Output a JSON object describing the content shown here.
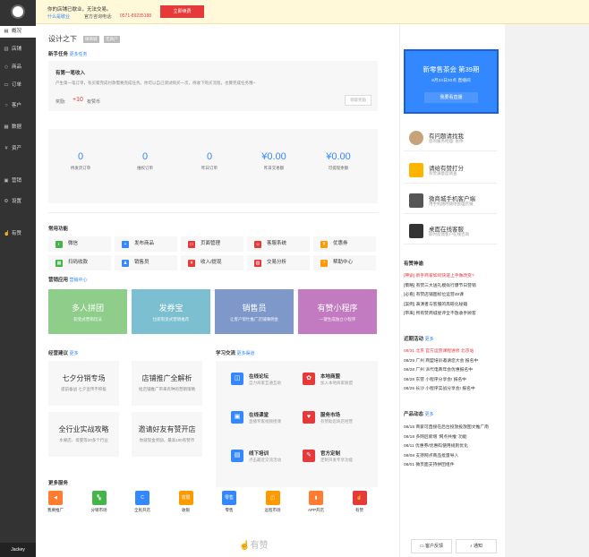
{
  "sidebar": {
    "user": "Jackey",
    "items": [
      {
        "label": "概况",
        "icon": "home-icon",
        "glyph": "▤",
        "active": true
      },
      {
        "label": "店铺",
        "icon": "store-icon",
        "glyph": "▥",
        "active": false
      },
      {
        "label": "商品",
        "icon": "tag-icon",
        "glyph": "◇",
        "active": false
      },
      {
        "label": "订单",
        "icon": "order-icon",
        "glyph": "▭",
        "active": false
      },
      {
        "label": "客户",
        "icon": "user-icon",
        "glyph": "○",
        "active": false
      },
      {
        "label": "数据",
        "icon": "chart-icon",
        "glyph": "▦",
        "active": false
      },
      {
        "label": "资产",
        "icon": "wallet-icon",
        "glyph": "¥",
        "active": false
      },
      {
        "label": "营销",
        "icon": "marketing-icon",
        "glyph": "▣",
        "active": false
      },
      {
        "label": "设置",
        "icon": "gear-icon",
        "glyph": "⚙",
        "active": false
      },
      {
        "label": "有赞",
        "icon": "thumb-icon",
        "glyph": "☝",
        "active": false
      }
    ]
  },
  "notice": {
    "text": "你的店铺已歇业，无法交易。",
    "link": "什么是歇业",
    "phone_label": "官方咨询电话:",
    "phone": "0571-89235188",
    "button": "立即续费"
  },
  "header": {
    "title": "设计之下",
    "tag1": "微商城",
    "tag2": "无商户"
  },
  "task": {
    "section": "新手任务",
    "more": "更多任务",
    "title": "有第一笔收入",
    "desc": "产生第一笔订单，有买家完成付款需要完成任务。你可以自己测试购买一次，待收下购买流程，也算完成任务哦~",
    "reward_label": "奖励:",
    "reward_value": "+10",
    "reward_unit": "有赞币",
    "claim": "领取奖励"
  },
  "stats": [
    {
      "value": "0",
      "label": "待发货订单"
    },
    {
      "value": "0",
      "label": "维权订单"
    },
    {
      "value": "0",
      "label": "昨日订单"
    },
    {
      "value": "¥0.00",
      "label": "昨日交易额"
    },
    {
      "value": "¥0.00",
      "label": "可提现余额"
    }
  ],
  "functions": {
    "section": "常用功能",
    "items": [
      {
        "label": "微信",
        "icon": "wechat-icon",
        "color": "#44b549",
        "glyph": "◐"
      },
      {
        "label": "发布商品",
        "icon": "publish-icon",
        "color": "#3388ff",
        "glyph": "+"
      },
      {
        "label": "页面管理",
        "icon": "page-icon",
        "color": "#e5393a",
        "glyph": "▭"
      },
      {
        "label": "客服系统",
        "icon": "service-icon",
        "color": "#e5393a",
        "glyph": "☺"
      },
      {
        "label": "优惠券",
        "icon": "coupon-icon",
        "color": "#ff9900",
        "glyph": "¥"
      },
      {
        "label": "扫码收款",
        "icon": "scan-icon",
        "color": "#44b549",
        "glyph": "▦"
      },
      {
        "label": "销售员",
        "icon": "seller-icon",
        "color": "#3388ff",
        "glyph": "♟"
      },
      {
        "label": "收入/提现",
        "icon": "income-icon",
        "color": "#e5393a",
        "glyph": "¥"
      },
      {
        "label": "交易分析",
        "icon": "analysis-icon",
        "color": "#e5393a",
        "glyph": "▥"
      },
      {
        "label": "帮助中心",
        "icon": "help-icon",
        "color": "#ff9900",
        "glyph": "?"
      }
    ]
  },
  "apps": {
    "section": "营销应用",
    "more": "营销中心",
    "items": [
      {
        "title": "多人拼团",
        "sub": "裂变式营销玩法",
        "color": "#8fce8a"
      },
      {
        "title": "发券宝",
        "sub": "拉新裂变式营销推荐",
        "color": "#7cbfd0"
      },
      {
        "title": "销售员",
        "sub": "让客户帮忙推广店铺赚佣金",
        "color": "#7d98c9"
      },
      {
        "title": "有赞小程序",
        "sub": "一键生成独立小程序",
        "color": "#c27ac0"
      }
    ]
  },
  "advice": {
    "section": "经营建议",
    "more": "更多",
    "items": [
      {
        "title": "七夕分销专场",
        "sub": "提前备战 七夕宣传不积极"
      },
      {
        "title": "店铺推广全解析",
        "sub": "给店铺推广带来有种的营销策略"
      },
      {
        "title": "全行业实战攻略",
        "sub": "水果店、母婴等20多个行业"
      },
      {
        "title": "邀请好友有赞开店",
        "sub": "你就现金奖励，最高100有赞币"
      }
    ]
  },
  "learn": {
    "section": "学习交流",
    "more": "更多渠道",
    "items": [
      {
        "title": "在线论坛",
        "sub": "自力商家互通互助",
        "icon": "forum-icon",
        "color": "#3388ff",
        "glyph": "◫"
      },
      {
        "title": "本地商盟",
        "sub": "加入本地商家联盟",
        "icon": "alliance-icon",
        "color": "#e5393a",
        "glyph": "✿"
      },
      {
        "title": "在线课堂",
        "sub": "直播专家视频授课",
        "icon": "classroom-icon",
        "color": "#3388ff",
        "glyph": "▣"
      },
      {
        "title": "服务市场",
        "sub": "有赞助您商店经营",
        "icon": "market-icon",
        "color": "#e5393a",
        "glyph": "♥"
      },
      {
        "title": "线下培训",
        "sub": "点击最近交流活动",
        "icon": "training-icon",
        "color": "#3388ff",
        "glyph": "▤"
      },
      {
        "title": "官方定制",
        "sub": "定制开发专享功能",
        "icon": "custom-icon",
        "color": "#e5393a",
        "glyph": "✎"
      }
    ]
  },
  "more_services": {
    "section": "更多服务",
    "items": [
      {
        "label": "我要推广",
        "icon": "promote-icon",
        "color": "#ff7c30",
        "glyph": "◀"
      },
      {
        "label": "分销市场",
        "icon": "distribution-icon",
        "color": "#44b549",
        "glyph": "▚"
      },
      {
        "label": "全民开店",
        "icon": "shop-icon",
        "color": "#3388ff",
        "glyph": "C"
      },
      {
        "label": "收银",
        "icon": "cashier-icon",
        "color": "#ff9900",
        "glyph": "收银"
      },
      {
        "label": "零售",
        "icon": "retail-icon",
        "color": "#3388ff",
        "glyph": "零售"
      },
      {
        "label": "远程市场",
        "icon": "remote-icon",
        "color": "#ff9900",
        "glyph": "◰"
      },
      {
        "label": "APP开店",
        "icon": "app-icon",
        "color": "#ff7c30",
        "glyph": "▮"
      },
      {
        "label": "有赞",
        "icon": "youzan-icon",
        "color": "#e5393a",
        "glyph": "☝"
      }
    ]
  },
  "footer": {
    "brand": "有赞"
  },
  "right": {
    "promo": {
      "title": "新零售茶会 第39期",
      "sub": "8月24日20点 直播间",
      "button": "我要看直播"
    },
    "contacts": [
      {
        "title": "有问题请找我",
        "sub": "您的服务经理: 张伟",
        "icon": "avatar"
      },
      {
        "title": "请给有赞打分",
        "sub": "有赞满意度调查",
        "icon": "mail-icon"
      },
      {
        "title": "微商城手机客户端",
        "sub": "用手机随时随地管理店铺",
        "icon": "phone-icon"
      },
      {
        "title": "桌面在线客服",
        "sub": "即时反馈客户在线咨询",
        "icon": "desktop-icon"
      }
    ],
    "notices": {
      "section": "有赞神谕",
      "items": [
        "[神谕] 新手商家如何快速上手做改变?",
        "[策略] 有赞三大送礼模拟行爆节日营销",
        "[必看] 有赞店铺图标位运营49课",
        "[案例] 表演者与客服的高研化秘籍",
        "[带来] 所有赞商城星评全不放收手顾客"
      ]
    },
    "events": {
      "section": "近期活动",
      "more": "更多",
      "items": [
        "08/31 北京 官方运营课程进修 北京站",
        "08/29 广州 商盟培训邀请您大会 报名中",
        "08/28 广州 派代电商年会优惠报名中",
        "08/28 东营 小程序分享会! 报名中",
        "08/25 长沙 小程序实战分享会! 报名中"
      ]
    },
    "product": {
      "section": "产品动态",
      "more": "更多",
      "items": [
        "08/18 商家可直接在后台投放投放图文推广南",
        "08/18 多网后新增 '网点共推' 功能",
        "08/11 优惠券/优惠码使用规则优化",
        "08/08 支持网点商品批量导入",
        "08/01 微页面支持拼团组件"
      ]
    },
    "footer": {
      "service": "客户反馈",
      "notify": "通知"
    }
  }
}
